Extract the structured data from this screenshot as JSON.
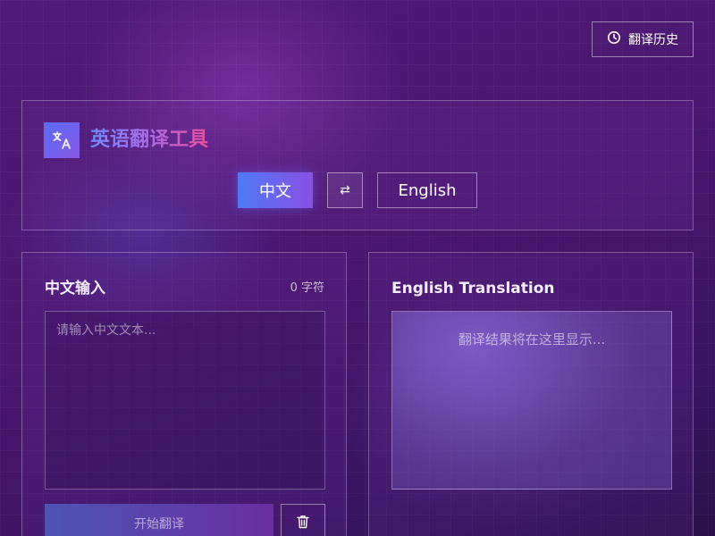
{
  "header": {
    "history_label": "翻译历史",
    "app_title": "英语翻译工具"
  },
  "languages": {
    "source": "中文",
    "swap_symbol": "⇄",
    "target": "English"
  },
  "input_panel": {
    "title": "中文输入",
    "char_count": "0 字符",
    "placeholder": "请输入中文文本...",
    "value": "",
    "translate_label": "开始翻译"
  },
  "output_panel": {
    "title": "English Translation",
    "placeholder": "翻译结果将在这里显示..."
  },
  "colors": {
    "accent_start": "#4e7af5",
    "accent_end": "#8a4fe5",
    "title_gradient_start": "#6f8bff",
    "title_gradient_end": "#ec4f9a",
    "background": "#4a176f"
  },
  "icons": {
    "history": "clock-icon",
    "logo": "translate-icon",
    "swap": "swap-arrows-icon",
    "clear": "trash-icon"
  }
}
